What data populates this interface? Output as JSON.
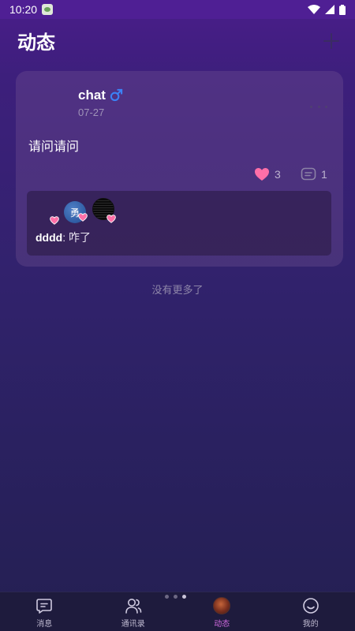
{
  "status_bar": {
    "time": "10:20",
    "icons": [
      "app-notification-icon",
      "wifi-icon",
      "signal-icon",
      "battery-icon"
    ]
  },
  "header": {
    "title": "动态",
    "add_icon": "plus-icon"
  },
  "post": {
    "author": "chat",
    "gender_symbol": "♂",
    "date": "07-27",
    "text": "请问请问",
    "like_count": "3",
    "comment_count": "1",
    "likers": [
      {
        "avatar_text": "勇"
      },
      {
        "avatar_text": ""
      }
    ],
    "comments": [
      {
        "author": "dddd",
        "separator": ": ",
        "text": "咋了"
      }
    ]
  },
  "feed": {
    "end_text": "没有更多了"
  },
  "bottom_nav": {
    "items": [
      {
        "label": "消息",
        "icon": "message-icon"
      },
      {
        "label": "通讯录",
        "icon": "contacts-icon"
      },
      {
        "label": "动态",
        "icon": "moments-avatar-icon",
        "active": true
      },
      {
        "label": "我的",
        "icon": "profile-smile-icon"
      }
    ]
  },
  "colors": {
    "accent_active": "#d16ae0",
    "like_heart": "#ff6fa8",
    "gender_male": "#3b82f6"
  }
}
